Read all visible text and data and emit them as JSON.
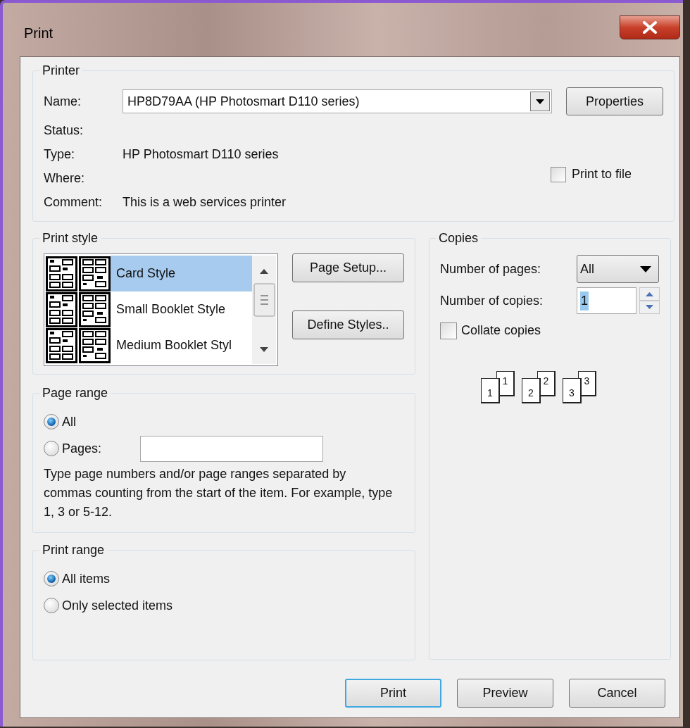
{
  "window": {
    "title": "Print"
  },
  "printer": {
    "label": "Printer",
    "name_label": "Name:",
    "name_value": "HP8D79AA (HP Photosmart D110 series)",
    "properties_button": "Properties",
    "fields": [
      {
        "label": "Status:"
      },
      {
        "label": "Type:",
        "value": "HP Photosmart D110 series"
      },
      {
        "label": "Where:"
      },
      {
        "label": "Comment:",
        "value": "This is a web services printer"
      }
    ],
    "print_to_file": {
      "label": "Print to file",
      "checked": false
    }
  },
  "print_style": {
    "label": "Print style",
    "items": [
      {
        "label": "Card Style",
        "selected": true
      },
      {
        "label": "Small Booklet Style",
        "selected": false
      },
      {
        "label": "Medium Booklet Styl",
        "selected": false
      }
    ],
    "buttons": [
      "Page Setup...",
      "Define Styles.."
    ]
  },
  "copies": {
    "label": "Copies",
    "pages_label": "Number of pages:",
    "pages_value": "All",
    "copies_label": "Number of copies:",
    "copies_value": "1",
    "collate": {
      "label": "Collate copies",
      "checked": false
    },
    "collation_sets": [
      [
        "1",
        "1"
      ],
      [
        "2",
        "2"
      ],
      [
        "3",
        "3"
      ]
    ]
  },
  "page_range": {
    "label": "Page range",
    "options": [
      {
        "label": "All",
        "selected": true
      },
      {
        "label": "Pages:",
        "selected": false
      }
    ],
    "help": "Type page numbers and/or page ranges separated by commas counting from the start of the item.  For example, type 1, 3 or 5-12."
  },
  "print_range": {
    "label": "Print range",
    "options": [
      {
        "label": "All items",
        "selected": true
      },
      {
        "label": "Only selected items",
        "selected": false
      }
    ]
  },
  "buttons": [
    {
      "label": "Print",
      "default": true
    },
    {
      "label": "Preview",
      "default": false
    },
    {
      "label": "Cancel",
      "default": false
    }
  ]
}
